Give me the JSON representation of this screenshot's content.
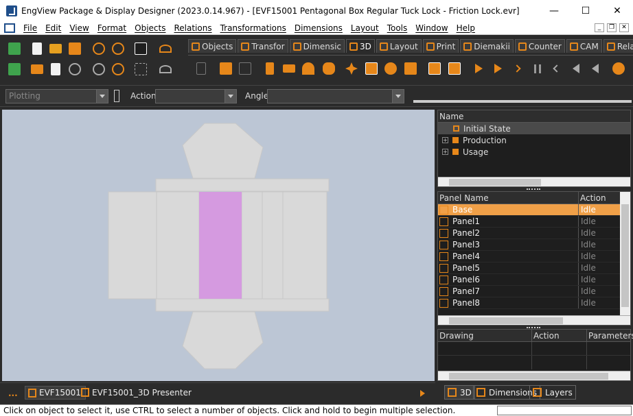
{
  "window": {
    "title": "EngView Package & Display Designer (2023.0.14.967) - [EVF15001 Pentagonal Box Regular Tuck Lock - Friction Lock.evr]"
  },
  "menu": [
    "File",
    "Edit",
    "View",
    "Format",
    "Objects",
    "Relations",
    "Transformations",
    "Dimensions",
    "Layout",
    "Tools",
    "Window",
    "Help"
  ],
  "tabs": [
    "Objects",
    "Transfor",
    "Dimensic",
    "3D",
    "Layout",
    "Print",
    "Diemakii",
    "Counter",
    "CAM",
    "Relation"
  ],
  "options": {
    "mode": "Plotting",
    "action_label": "Action",
    "angle_label": "Angle"
  },
  "tree": {
    "header": "Name",
    "items": [
      {
        "label": "Initial State",
        "expandable": false
      },
      {
        "label": "Production",
        "expandable": true
      },
      {
        "label": "Usage",
        "expandable": true
      }
    ]
  },
  "panels": {
    "header_name": "Panel Name",
    "header_action": "Action",
    "rows": [
      {
        "name": "Base",
        "action": "Idle"
      },
      {
        "name": "Panel1",
        "action": "Idle"
      },
      {
        "name": "Panel2",
        "action": "Idle"
      },
      {
        "name": "Panel3",
        "action": "Idle"
      },
      {
        "name": "Panel4",
        "action": "Idle"
      },
      {
        "name": "Panel5",
        "action": "Idle"
      },
      {
        "name": "Panel6",
        "action": "Idle"
      },
      {
        "name": "Panel7",
        "action": "Idle"
      },
      {
        "name": "Panel8",
        "action": "Idle"
      }
    ]
  },
  "drawing": {
    "h1": "Drawing",
    "h2": "Action",
    "h3": "Parameters"
  },
  "doc_tabs": {
    "more": "...",
    "t1": "EVF15001",
    "t2": "EVF15001_3D Presenter"
  },
  "bottom_tabs": [
    "3D",
    "Dimensions",
    "Layers"
  ],
  "status": "Click on object to select it, use CTRL to select a number of objects. Click and hold to begin multiple selection.",
  "colors": {
    "accent": "#e6871a",
    "selected_panel": "#d59ae0",
    "viewport": "#bcc6d5",
    "box": "#d9d9d9"
  }
}
